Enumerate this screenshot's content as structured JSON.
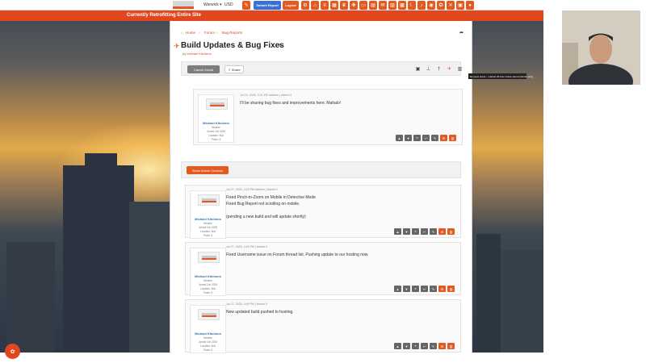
{
  "nav": {
    "user_label": "Warwick ▾",
    "currency": "USD",
    "submit_report_label": "Submit Report",
    "logout_label": "Logout"
  },
  "banner": {
    "text": "Currently Retrofitting Entire Site"
  },
  "breadcrumbs": [
    "Home",
    "Forum",
    "Bug Reports"
  ],
  "thread": {
    "title": "Build Updates & Bug Fixes",
    "byline_prefix": "by",
    "author": "Michael Kitchens",
    "cancel_label": "Cancel Invoid",
    "share_label": "Share"
  },
  "tooltip": {
    "text": "Remove boost – Cancel 24-hour boost period (Admin only)"
  },
  "admin": {
    "button_label": "Show Admin Controls"
  },
  "posts": [
    {
      "user": {
        "name": "Michael Kitchens",
        "role": "Newbie",
        "joined": "Joined Oct 2025",
        "location": "Location: N/A",
        "posts": "Posts: 5"
      },
      "meta": "Jul 22, 2025, 3:21 PM  #Admin  |  Admin 0",
      "body": [
        "I'll be sharing bug fixes and improvements here. Mahalo!"
      ]
    },
    {
      "user": {
        "name": "Michael Kitchens",
        "role": "Newbie",
        "joined": "Joined Oct 2025",
        "location": "Location: N/A",
        "posts": "Posts: 5"
      },
      "meta": "Jul 27, 2025, 3:23 PM  #admin  |  Admin 0",
      "body": [
        "Fixed Pinch-to-Zoom on Mobile in Detective Mode",
        "Fixed Bug Report not scrolling on mobile.",
        "",
        "(pending a new build and will update shortly)"
      ]
    },
    {
      "user": {
        "name": "Michael Kitchens",
        "role": "Newbie",
        "joined": "Joined Oct 2025",
        "location": "Location: N/A",
        "posts": "Posts: 5"
      },
      "meta": "Jul 27, 2025, 4:49 PM  |  Admin 0",
      "body": [
        "Fixed Username issue on Forum thread list. Pushing update to our hosting now."
      ]
    },
    {
      "user": {
        "name": "Michael Kitchens",
        "role": "Newbie",
        "joined": "Joined Oct 2025",
        "location": "Location: N/A",
        "posts": "Posts: 5"
      },
      "meta": "Jul 27, 2025, 4:49 PM  |  Admin 0",
      "body": [
        "New updated build pushed to hosting."
      ]
    }
  ],
  "colors": {
    "accent": "#e1471e",
    "link": "#2a6fb4"
  }
}
